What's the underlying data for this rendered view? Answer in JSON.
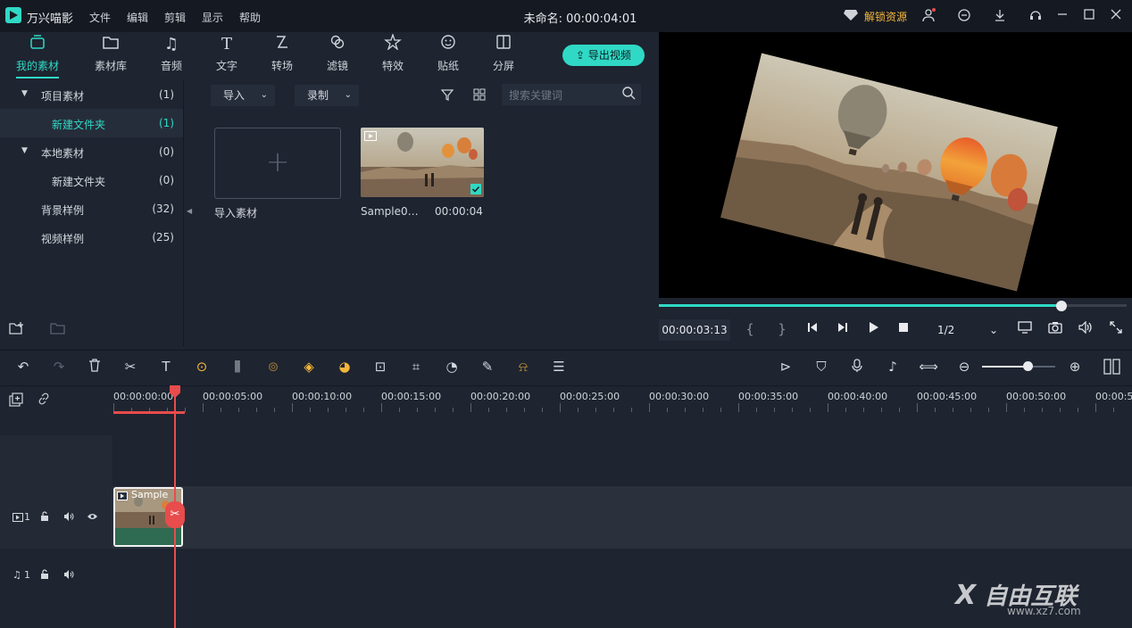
{
  "titlebar": {
    "app_name": "万兴喵影",
    "menus": [
      "文件",
      "编辑",
      "剪辑",
      "显示",
      "帮助"
    ],
    "project_title": "未命名: 00:00:04:01",
    "unlock_label": "解锁资源"
  },
  "tabs": [
    {
      "label": "我的素材",
      "icon": "my-media-icon",
      "active": true
    },
    {
      "label": "素材库",
      "icon": "folder-icon"
    },
    {
      "label": "音频",
      "icon": "music-note-icon"
    },
    {
      "label": "文字",
      "icon": "text-icon"
    },
    {
      "label": "转场",
      "icon": "transition-icon"
    },
    {
      "label": "滤镜",
      "icon": "filter-icon"
    },
    {
      "label": "特效",
      "icon": "effects-icon"
    },
    {
      "label": "贴纸",
      "icon": "sticker-icon"
    },
    {
      "label": "分屏",
      "icon": "split-screen-icon"
    }
  ],
  "export_label": "导出视频",
  "tree": [
    {
      "label": "项目素材",
      "count": "(1)",
      "expandable": true
    },
    {
      "label": "新建文件夹",
      "count": "(1)",
      "selected": true
    },
    {
      "label": "本地素材",
      "count": "(0)",
      "expandable": true
    },
    {
      "label": "新建文件夹",
      "count": "(0)"
    },
    {
      "label": "背景样例",
      "count": "(32)"
    },
    {
      "label": "视频样例",
      "count": "(25)"
    }
  ],
  "library": {
    "import_dropdown": "导入",
    "record_dropdown": "录制",
    "search_placeholder": "搜索关键词",
    "import_tile_caption": "导入素材",
    "media_name": "Sample0…",
    "media_duration": "00:00:04"
  },
  "preview": {
    "timecode": "00:00:03:13",
    "brace_open": "{",
    "brace_close": "}",
    "ratio": "1/2",
    "progress": 0.86
  },
  "timeline": {
    "ruler": [
      "00:00:00:00",
      "00:00:05:00",
      "00:00:10:00",
      "00:00:15:00",
      "00:00:20:00",
      "00:00:25:00",
      "00:00:30:00",
      "00:00:35:00",
      "00:00:40:00",
      "00:00:45:00",
      "00:00:50:00",
      "00:00:5"
    ],
    "clip_label": "Sample",
    "video_track": "1",
    "audio_track": "1",
    "zoom_level": 0.62
  },
  "watermark": {
    "text": "自由互联",
    "url": "www.xz7.com"
  },
  "colors": {
    "accent": "#2fd9c5",
    "playhead": "#e84c4c",
    "unlock": "#f4b63c"
  }
}
